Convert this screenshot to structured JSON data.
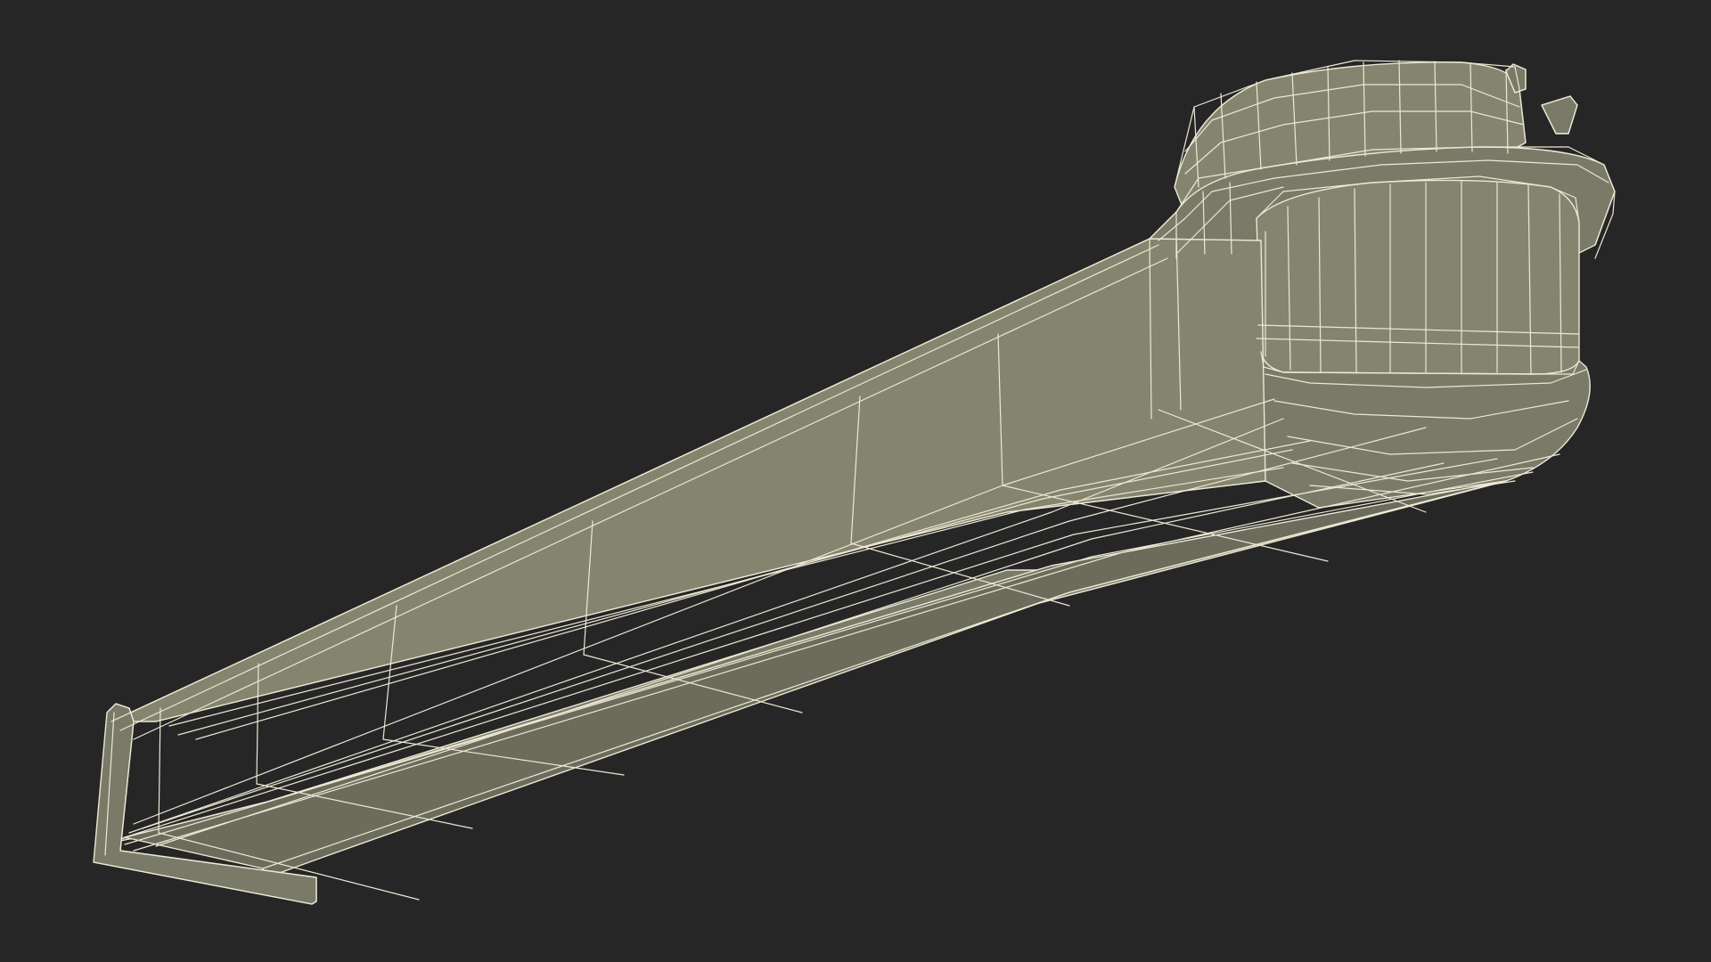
{
  "scene": {
    "background_color": "#262626",
    "model": {
      "kind": "wireframe-3d-model",
      "fill_color": "#7a7a68",
      "fill_dark_color": "#6c6c5c",
      "fill_light_color": "#85856f",
      "wire_color": "#ece8d4"
    }
  }
}
